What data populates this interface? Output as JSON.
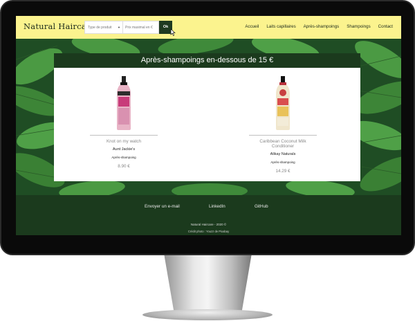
{
  "nav": {
    "brand": "Natural Haircare",
    "search_type_placeholder": "Type de produit",
    "search_price_placeholder": "Prix maximal en €",
    "ok_label": "Ok",
    "links": [
      "Accueil",
      "Laits capillaires",
      "Après-shampoings",
      "Shampoings",
      "Contact"
    ]
  },
  "main": {
    "title": "Après-shampoings en-dessous de 15 €",
    "products": [
      {
        "name": "Knot on my watch",
        "brand": "Aunt Jackie's",
        "category": "Après-shampoing",
        "price": "8.90 €"
      },
      {
        "name": "Caribbean Coconut Milk Conditioner",
        "brand": "Alikay Naturals",
        "category": "Après-shampoing",
        "price": "14.29 €"
      }
    ]
  },
  "footer": {
    "links": [
      "Envoyer un e-mail",
      "LinkedIn",
      "GitHub"
    ],
    "copyright": "Natural Haircare - 2020 ©",
    "credit": "Crédit photo : Youzz de Pixabay"
  },
  "colors": {
    "navbar_bg": "#fbf38e",
    "dark_green": "#1b3a1d",
    "leaf_green": "#3f8a3a"
  }
}
